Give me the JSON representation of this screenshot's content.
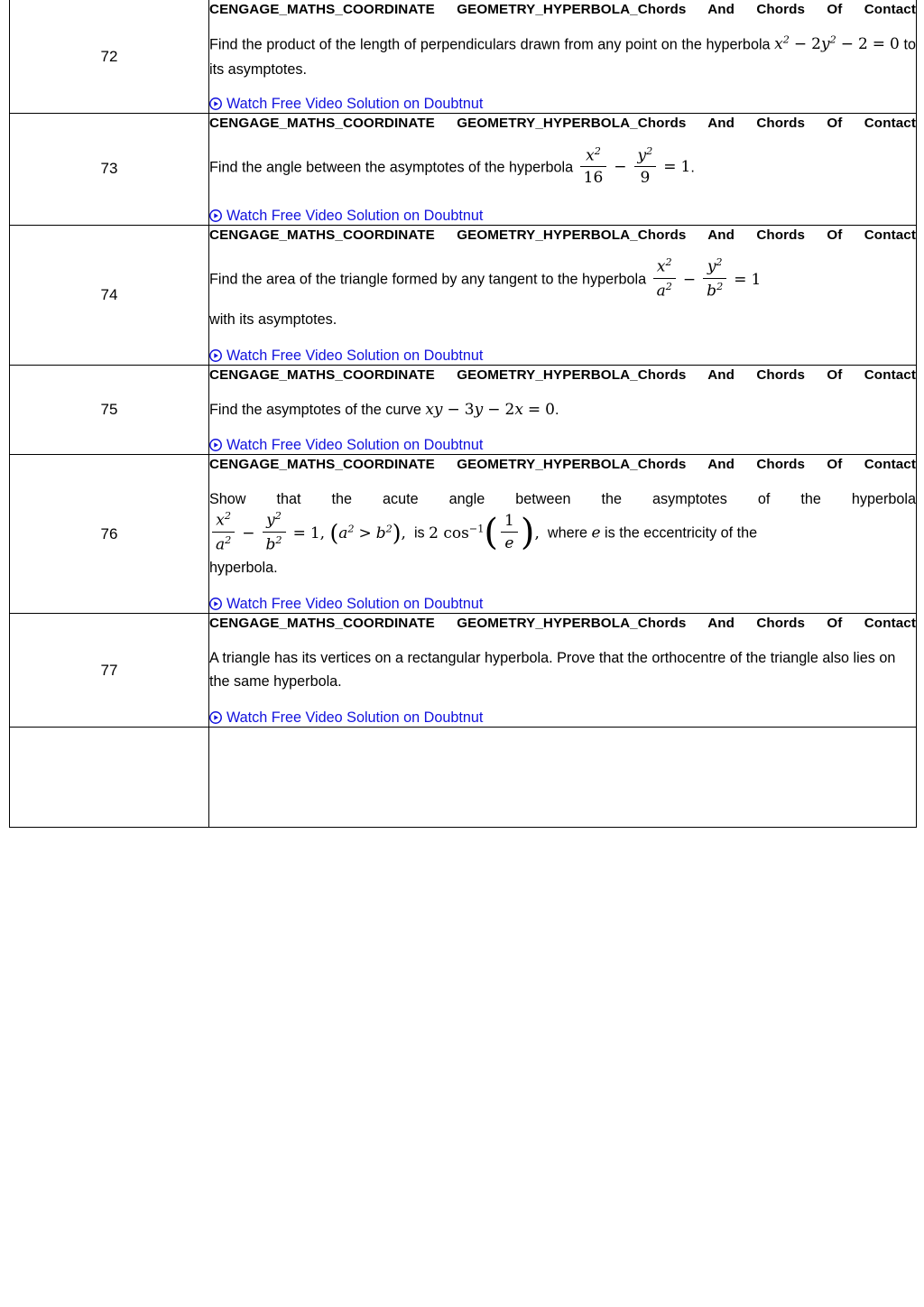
{
  "document": {
    "type": "question-table",
    "link_color": "#1111dd",
    "border_color": "#000000",
    "watch_link_label": "Watch Free Video Solution on Doubtnut",
    "play_icon": "circled-play-icon"
  },
  "chapter_heading": {
    "part1": "CENGAGE_MATHS_COORDINATE",
    "part2": "GEOMETRY_HYPERBOLA_Chords",
    "part3": "And",
    "part4": "Chords Of Contact",
    "full": "CENGAGE_MATHS_COORDINATE GEOMETRY_HYPERBOLA_Chords And Chords Of Contact"
  },
  "rows": [
    {
      "number": "72",
      "question_plain": "Find the product of the length of perpendiculars drawn from any point on the hyperbola x^2 - 2y^2 - 2 = 0 to its asymptotes.",
      "text_before": "Find the product of the length of perpendiculars drawn from any point on the hyperbola",
      "text_after": "to its asymptotes.",
      "formula": "x^2 - 2y^2 - 2 = 0",
      "watch_label": "Watch Free Video Solution on Doubtnut"
    },
    {
      "number": "73",
      "question_plain": "Find the angle between the asymptotes of the hyperbola x^2/16 - y^2/9 = 1 .",
      "text_before": "Find the angle between the asymptotes of the hyperbola",
      "text_after": ".",
      "formula": "x^2/16 - y^2/9 = 1",
      "fraction1_num": "x",
      "fraction1_den": "16",
      "fraction2_num": "y",
      "fraction2_den": "9",
      "rhs": "1",
      "watch_label": "Watch Free Video Solution on Doubtnut"
    },
    {
      "number": "74",
      "question_plain": "Find the area of the triangle formed by any tangent to the hyperbola x^2/a^2 - y^2/b^2 = 1 with its asymptotes.",
      "text_before": "Find the area of the triangle formed by any tangent to the hyperbola",
      "text_after": "with its asymptotes.",
      "formula": "x^2/a^2 - y^2/b^2 = 1",
      "fraction1_num": "x",
      "fraction1_den": "a",
      "fraction2_num": "y",
      "fraction2_den": "b",
      "rhs": "1",
      "watch_label": "Watch Free Video Solution on Doubtnut"
    },
    {
      "number": "75",
      "question_plain": "Find the asymptotes of the curve xy - 3y - 2x = 0 .",
      "text_before": "Find the asymptotes of the curve",
      "text_after": ".",
      "formula": "xy - 3y - 2x = 0",
      "watch_label": "Watch Free Video Solution on Doubtnut"
    },
    {
      "number": "76",
      "question_plain": "Show that the acute angle between the asymptotes of the hyperbola x^2/a^2 - y^2/b^2 = 1, (a^2 > b^2), is 2 cos^-1 (1/e), where e is the eccentricity of the hyperbola.",
      "text_before": "Show that the acute angle between the asymptotes of the hyperbola",
      "text_middle": "is",
      "text_after": "where",
      "text_after2": "is the eccentricity of the",
      "text_after3": "hyperbola.",
      "formula": "x^2/a^2 - y^2/b^2 = 1, (a^2 > b^2)",
      "formula2": "2 cos^-1 (1/e)",
      "variable": "e",
      "watch_label": "Watch Free Video Solution on Doubtnut"
    },
    {
      "number": "77",
      "question_plain": "A triangle has its vertices on a rectangular hyperbola. Prove that the orthocentre of the triangle also lies on the same hyperbola.",
      "text_before": "A triangle has its vertices on a rectangular hyperbola. Prove that the orthocentre of the triangle also lies on the same hyperbola.",
      "watch_label": "Watch Free Video Solution on Doubtnut"
    },
    {
      "number": "",
      "question_plain": "",
      "watch_label": ""
    }
  ]
}
